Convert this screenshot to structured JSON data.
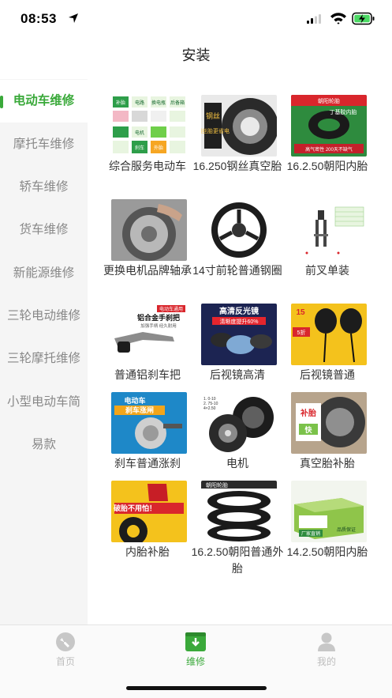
{
  "status_bar": {
    "time": "08:53"
  },
  "nav": {
    "title": "安装"
  },
  "sidebar": {
    "items": [
      {
        "label": "电动车维修",
        "active": true
      },
      {
        "label": "摩托车维修",
        "active": false
      },
      {
        "label": "轿车维修",
        "active": false
      },
      {
        "label": "货车维修",
        "active": false
      },
      {
        "label": "新能源维修",
        "active": false
      },
      {
        "label": "三轮电动维修",
        "active": false
      },
      {
        "label": "三轮摩托维修",
        "active": false
      },
      {
        "label": "小型电动车简",
        "active": false
      },
      {
        "label": "易款",
        "active": false
      }
    ]
  },
  "products": [
    {
      "label": "综合服务电动车",
      "image_texts": [
        "补胎",
        "电路",
        "换电瓶",
        "后备箱",
        "电机",
        "刹车",
        "外胎"
      ]
    },
    {
      "label": "16.250钢丝真空胎",
      "image_texts": [
        "钢丝胎更省电"
      ]
    },
    {
      "label": "16.2.50朝阳内胎",
      "image_texts": [
        "朝阳轮胎",
        "丁基胶内胎",
        "高气密性 200天不缺气"
      ]
    },
    {
      "label": "更换电机品牌轴承",
      "image_texts": []
    },
    {
      "label": "14寸前轮普通钢圈",
      "image_texts": []
    },
    {
      "label": "前叉单装",
      "image_texts": []
    },
    {
      "label": "普通铝刹车把",
      "image_texts": [
        "电动车通用",
        "铝合金手刹把",
        "加强手柄 经久耐用"
      ]
    },
    {
      "label": "后视镜高清",
      "image_texts": [
        "高清反光镜",
        "清晰度提升60%"
      ]
    },
    {
      "label": "后视镜普通",
      "image_texts": [
        "15",
        "5折"
      ]
    },
    {
      "label": "刹车普通涨刹",
      "image_texts": [
        "电动车",
        "刹车涨闸"
      ]
    },
    {
      "label": "电机",
      "image_texts": []
    },
    {
      "label": "真空胎补胎",
      "image_texts": [
        "补胎",
        "快"
      ]
    },
    {
      "label": "内胎补胎",
      "image_texts": [
        "破胎不用怕！"
      ]
    },
    {
      "label": "16.2.50朝阳普通外胎",
      "image_texts": [
        "朝阳轮胎"
      ]
    },
    {
      "label": "14.2.50朝阳内胎",
      "image_texts": [
        "厂家直销",
        "品质保证"
      ]
    }
  ],
  "tabbar": {
    "items": [
      {
        "label": "首页",
        "icon": "wrench-circle-icon",
        "active": false
      },
      {
        "label": "维修",
        "icon": "download-box-icon",
        "active": true
      },
      {
        "label": "我的",
        "icon": "person-icon",
        "active": false
      }
    ]
  },
  "colors": {
    "accent": "#3aa93a",
    "sidebar_bg": "#f5f5f5",
    "inactive": "#bdbdbd"
  }
}
